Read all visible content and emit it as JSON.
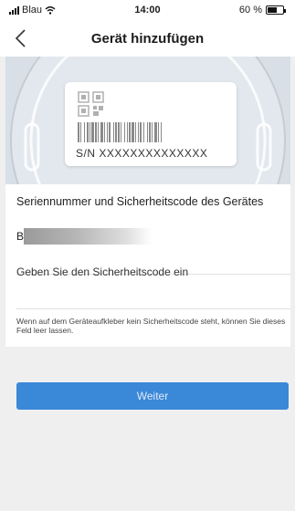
{
  "status_bar": {
    "carrier": "Blau",
    "time": "14:00",
    "battery_percent": "60 %",
    "battery_level": 0.6,
    "icons": [
      "signal-icon",
      "wifi-icon",
      "battery-icon"
    ]
  },
  "nav": {
    "title": "Gerät hinzufügen",
    "back_icon": "chevron-left-icon"
  },
  "hero": {
    "serial_label": "S/N  XXXXXXXXXXXXXX",
    "icons": [
      "qr-code-icon",
      "barcode-icon"
    ]
  },
  "form": {
    "section_title": "Seriennummer und Sicherheitscode des Gerätes",
    "serial_prefix": "B",
    "code_placeholder": "Geben Sie den Sicherheitscode ein",
    "hint": "Wenn auf dem Geräteaufkleber kein Sicherheitscode steht, können Sie dieses Feld leer lassen."
  },
  "actions": {
    "next_label": "Weiter"
  },
  "colors": {
    "accent": "#3a88d8",
    "background": "#efefef",
    "hero_background": "#d9dfe6"
  }
}
